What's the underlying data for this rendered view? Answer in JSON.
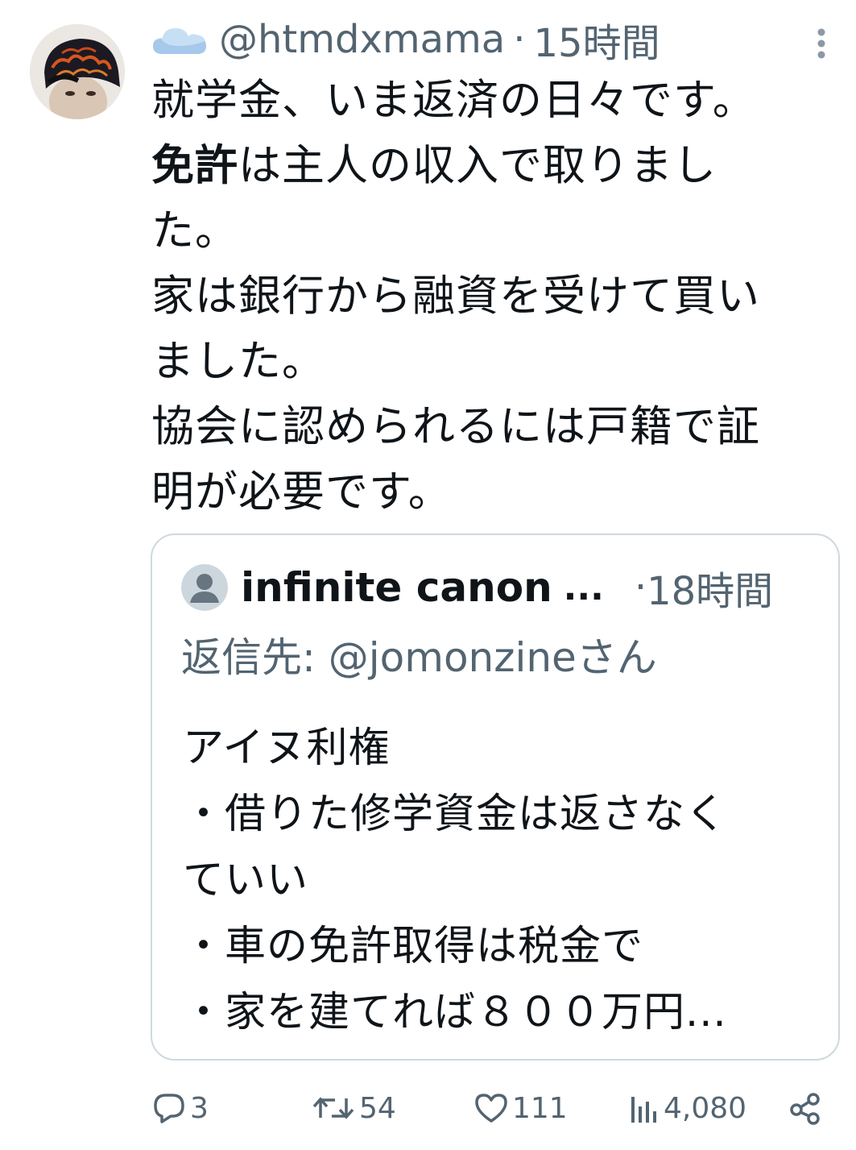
{
  "tweet": {
    "header": {
      "status_emoji": "☁️",
      "handle": "@htmdxmama",
      "separator": "·",
      "time": "15時間"
    },
    "body": {
      "line1": "就学金、いま返済の日々です。",
      "line2_bold": "免許",
      "line2_rest": "は主人の収入で取りまし",
      "line3": "た。",
      "line4": "家は銀行から融資を受けて買い",
      "line5": "ました。",
      "line6": "協会に認められるには戸籍で証",
      "line7": "明が必要です。"
    },
    "quote": {
      "name": "infinite canon",
      "name_ellipsis": "...",
      "separator": "·",
      "time": "18時間",
      "reply_prefix": "返信先: ",
      "reply_handle": "@jomonzine",
      "reply_suffix": "さん",
      "body": [
        "アイヌ利権",
        "・借りた修学資金は返さなく",
        "ていい",
        "・車の免許取得は税金で",
        "・家を建てれば８００万円..."
      ]
    },
    "actions": {
      "replies": "3",
      "retweets": "54",
      "likes": "111",
      "views": "4,080"
    },
    "colors": {
      "text": "#0f1419",
      "secondary": "#536471",
      "border": "#cfd9de"
    }
  }
}
